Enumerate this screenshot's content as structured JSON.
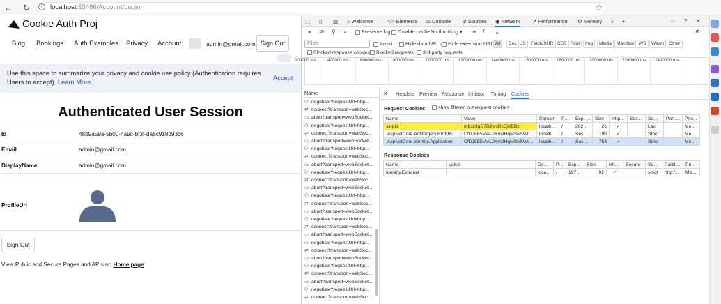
{
  "browser": {
    "url_host": "localhost",
    "url_rest": ":53486/Account/Login"
  },
  "app": {
    "brand": "Cookie Auth Proj",
    "nav": [
      "Blog",
      "Bookings",
      "Auth Examples",
      "Privacy",
      "Account"
    ],
    "user_email": "admin@gmail.com",
    "signout_label": "Sign Out",
    "cookie_text": "Use this space to summarize your privacy and cookie use policy (Authentication requires Users to accept).",
    "learn_more": "Learn More",
    "accept": "Accept",
    "heading": "Authenticated User Session",
    "fields": [
      {
        "label": "Id",
        "value": "48b9a59a-5b00-4a9c-bf3f-da6c918d93c6"
      },
      {
        "label": "Email",
        "value": "admin@gmail.com"
      },
      {
        "label": "DisplayName",
        "value": "admin@gmail.com"
      },
      {
        "label": "ProfileUrl",
        "value": ""
      }
    ],
    "signout_button": "Sign Out",
    "footer_prefix": "View Public and Secure Pages and APIs on ",
    "footer_link": "Home page",
    "footer_suffix": "."
  },
  "devtools": {
    "tabs": [
      "Welcome",
      "Elements",
      "Console",
      "Sources",
      "Network",
      "Performance",
      "Memory"
    ],
    "active_tab": "Network",
    "toolbar": {
      "preserve_log": "Preserve log",
      "disable_cache": "Disable cache",
      "throttle": "No throttling"
    },
    "filter": {
      "placeholder": "Filter",
      "invert": "Invert",
      "hide_data": "Hide data URLs",
      "hide_ext": "Hide extension URLs",
      "types": [
        "All",
        "Doc",
        "JS",
        "Fetch/XHR",
        "CSS",
        "Font",
        "Img",
        "Media",
        "Manifest",
        "WS",
        "Wasm",
        "Other"
      ],
      "blocked_cookies": "Blocked response cookies",
      "blocked_requests": "Blocked requests",
      "third_party": "3rd-party requests"
    },
    "overview_ticks": [
      "200000 ms",
      "400000 ms",
      "600000 ms",
      "800000 ms",
      "1000000 ms",
      "1200000 ms",
      "1400000 ms",
      "1600000 ms",
      "1800000 ms",
      "2000000 ms",
      "2200000 ms",
      "2400000 ms"
    ],
    "name_header": "Name",
    "requests": [
      {
        "kind": "neg",
        "name": "negotiate?requestUrl=http..."
      },
      {
        "kind": "conn",
        "name": "connect?transport=webSoc..."
      },
      {
        "kind": "doc",
        "name": "abort?transport=webSocket..."
      },
      {
        "kind": "neg",
        "name": "negotiate?requestUrl=http..."
      },
      {
        "kind": "conn",
        "name": "connect?transport=webSoc..."
      },
      {
        "kind": "doc",
        "name": "abort?transport=webSocket..."
      },
      {
        "kind": "neg",
        "name": "negotiate?requestUrl=http..."
      },
      {
        "kind": "conn",
        "name": "connect?transport=webSoc..."
      },
      {
        "kind": "doc",
        "name": "abort?transport=webSocket..."
      },
      {
        "kind": "neg",
        "name": "negotiate?requestUrl=http..."
      },
      {
        "kind": "conn",
        "name": "connect?transport=webSoc..."
      },
      {
        "kind": "doc",
        "name": "abort?transport=webSocket..."
      },
      {
        "kind": "neg",
        "name": "negotiate?requestUrl=http..."
      },
      {
        "kind": "conn",
        "name": "connect?transport=webSoc..."
      },
      {
        "kind": "doc",
        "name": "abort?transport=webSocket..."
      },
      {
        "kind": "neg",
        "name": "negotiate?requestUrl=http..."
      },
      {
        "kind": "conn",
        "name": "connect?transport=webSoc..."
      },
      {
        "kind": "doc",
        "name": "abort?transport=webSocket..."
      },
      {
        "kind": "neg",
        "name": "negotiate?requestUrl=http..."
      },
      {
        "kind": "conn",
        "name": "connect?transport=webSoc..."
      },
      {
        "kind": "doc",
        "name": "abort?transport=webSocket..."
      },
      {
        "kind": "neg",
        "name": "negotiate?requestUrl=http..."
      },
      {
        "kind": "conn",
        "name": "connect?transport=webSoc..."
      },
      {
        "kind": "doc",
        "name": "abort?transport=webSocket..."
      },
      {
        "kind": "neg",
        "name": "negotiate?requestUrl=http..."
      },
      {
        "kind": "conn",
        "name": "connect?transport=webSoc..."
      }
    ],
    "sub_tabs": [
      "Headers",
      "Preview",
      "Response",
      "Initiator",
      "Timing",
      "Cookies"
    ],
    "active_sub_tab": "Cookies",
    "request_cookies_title": "Request Cookies",
    "show_filtered": "show filtered out request cookies",
    "response_cookies_title": "Response Cookies",
    "columns": [
      "Name",
      "Value",
      "Domain",
      "Path",
      "Expire...",
      "Size",
      "Http...",
      "Secure",
      "Same...",
      "Partiti...",
      "Prio..."
    ],
    "request_cookies": [
      {
        "name": "ss-pid",
        "value": "mbsz9gD7D2wxRcSjXBBz",
        "domain": "localhost",
        "path": "/",
        "expires": "2025-...",
        "size": "26",
        "http": "✓",
        "secure": "",
        "same": "Lax",
        "part": "",
        "prio": "Medi..."
      },
      {
        "name": ".AspNetCore.Antiforgery.BVrbRudBl...",
        "value": "CfDJ8E5VvAJlYm9HqMSN5Wtq56...",
        "domain": "localhost",
        "path": "/",
        "expires": "Session",
        "size": "190",
        "http": "✓",
        "secure": "",
        "same": "Strict",
        "part": "",
        "prio": "Medi..."
      },
      {
        "name": ".AspNetCore.Identity.Application",
        "value": "CfDJ8E5VvAJlYm9HqMSN5Wtq56...",
        "domain": "localhost",
        "path": "/",
        "expires": "Session",
        "size": "763",
        "http": "✓",
        "secure": "",
        "same": "Strict",
        "part": "",
        "prio": "Medi..."
      }
    ],
    "response_cookies": [
      {
        "name": "Identity.External",
        "value": "",
        "domain": "local...",
        "path": "/",
        "expires": "1970-...",
        "size": "92",
        "http": "✓",
        "secure": "",
        "same": "strict",
        "part": "http:/...",
        "prio": "Medi..."
      }
    ]
  },
  "colors": {
    "accent": "#1a73e8",
    "highlight": "#ffee33",
    "link": "#2055b5",
    "banner": "#eef0f8"
  }
}
